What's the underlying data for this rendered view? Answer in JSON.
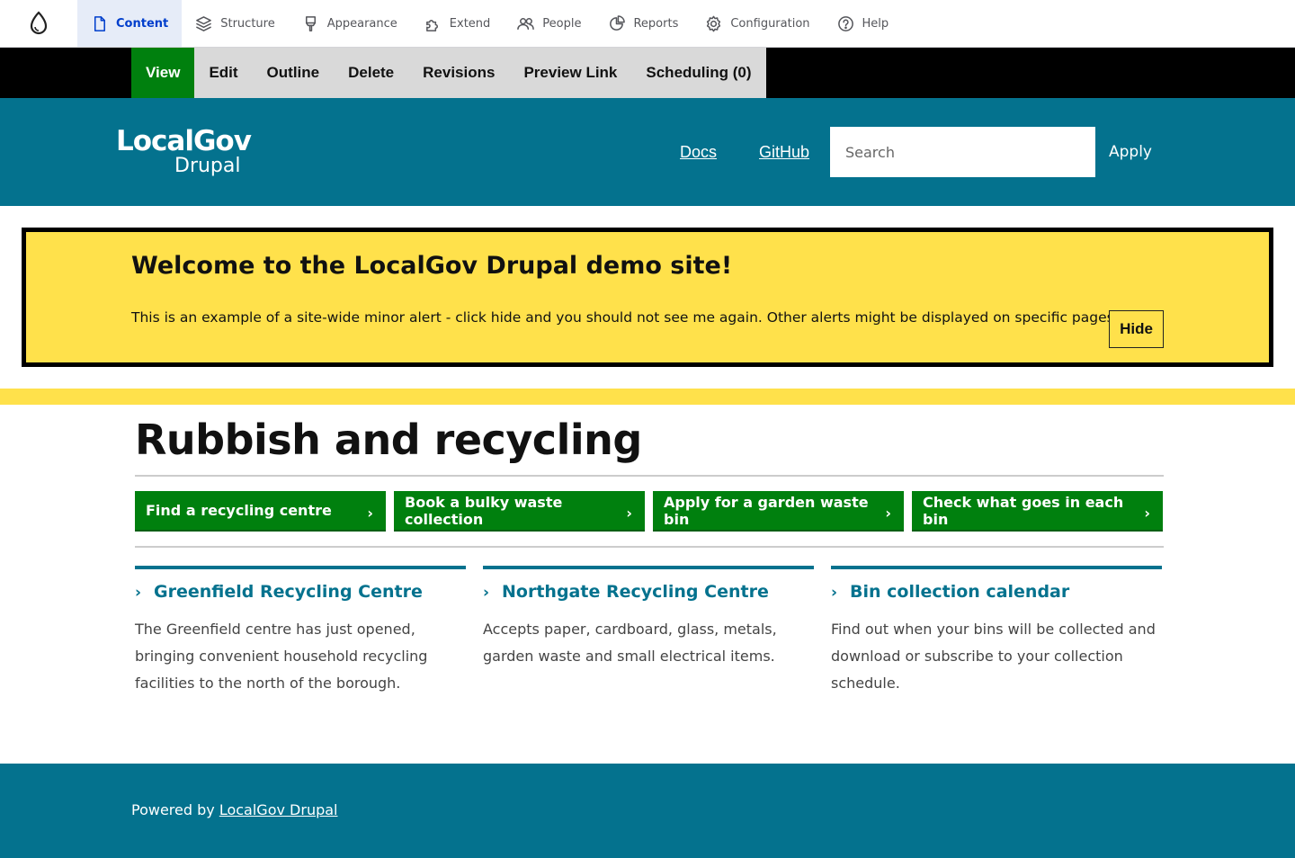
{
  "admin_toolbar": {
    "items": [
      {
        "label": "Content",
        "icon": "file-icon"
      },
      {
        "label": "Structure",
        "icon": "layers-icon"
      },
      {
        "label": "Appearance",
        "icon": "brush-icon"
      },
      {
        "label": "Extend",
        "icon": "puzzle-icon"
      },
      {
        "label": "People",
        "icon": "people-icon"
      },
      {
        "label": "Reports",
        "icon": "chart-pie-icon"
      },
      {
        "label": "Configuration",
        "icon": "gear-icon"
      },
      {
        "label": "Help",
        "icon": "question-icon"
      }
    ],
    "active_item": "Content"
  },
  "local_tasks": [
    "View",
    "Edit",
    "Outline",
    "Delete",
    "Revisions",
    "Preview Link",
    "Scheduling (0)"
  ],
  "local_tasks_active": "View",
  "header": {
    "logo_line1": "LocalGov",
    "logo_line2": "Drupal",
    "links": [
      "Docs",
      "GitHub"
    ],
    "search_placeholder": "Search",
    "apply_label": "Apply"
  },
  "alert": {
    "title": "Welcome to the LocalGov Drupal demo site!",
    "text": "This is an example of a site-wide minor alert - click hide and you should not see me again. Other alerts might be displayed on specific pages.",
    "hide_label": "Hide"
  },
  "main": {
    "title": "Rubbish and recycling",
    "ctas": [
      "Find a recycling centre",
      "Book a bulky waste collection",
      "Apply for a garden waste bin",
      "Check what goes in each bin"
    ],
    "cta_chevron": "›",
    "cards": [
      {
        "title": "Greenfield Recycling Centre",
        "description": "The Greenfield centre has just opened, bringing convenient household recycling facilities to the north of the borough."
      },
      {
        "title": "Northgate Recycling Centre",
        "description": "Accepts paper, cardboard, glass, metals, garden waste and small electrical items."
      },
      {
        "title": "Bin collection calendar",
        "description": "Find out when your bins will be collected and download or subscribe to your collection schedule."
      }
    ]
  },
  "footer": {
    "powered_by": "Powered by",
    "link": "LocalGov Drupal"
  },
  "colors": {
    "teal": "#04728e",
    "green": "#00800e",
    "yellow": "#ffe14b",
    "admin_active": "#003ecc"
  }
}
